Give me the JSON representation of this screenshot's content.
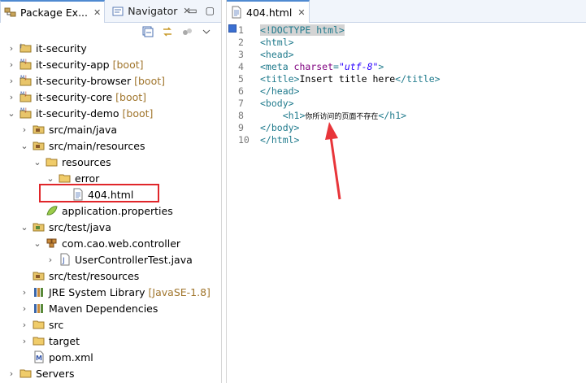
{
  "left_pane": {
    "tabs": [
      {
        "label": "Package Ex...",
        "active": true,
        "close": "✕"
      },
      {
        "label": "Navigator",
        "active": false,
        "close": "✕"
      }
    ],
    "tree": [
      {
        "label": "it-security",
        "suffix": "",
        "icon": "project-icon",
        "expanded": false,
        "depth": 0
      },
      {
        "label": "it-security-app",
        "suffix": "[boot]",
        "icon": "maven-project-icon",
        "expanded": false,
        "depth": 0
      },
      {
        "label": "it-security-browser",
        "suffix": "[boot]",
        "icon": "maven-project-icon",
        "expanded": false,
        "depth": 0
      },
      {
        "label": "it-security-core",
        "suffix": "[boot]",
        "icon": "maven-project-icon",
        "expanded": false,
        "depth": 0
      },
      {
        "label": "it-security-demo",
        "suffix": "[boot]",
        "icon": "maven-project-icon",
        "expanded": true,
        "depth": 0
      },
      {
        "label": "src/main/java",
        "suffix": "",
        "icon": "source-folder-icon",
        "expanded": false,
        "depth": 1
      },
      {
        "label": "src/main/resources",
        "suffix": "",
        "icon": "source-folder-icon",
        "expanded": true,
        "depth": 1
      },
      {
        "label": "resources",
        "suffix": "",
        "icon": "folder-icon",
        "expanded": true,
        "depth": 2
      },
      {
        "label": "error",
        "suffix": "",
        "icon": "folder-icon",
        "expanded": true,
        "depth": 3
      },
      {
        "label": "404.html",
        "suffix": "",
        "icon": "html-file-icon",
        "expanded": null,
        "depth": 4
      },
      {
        "label": "application.properties",
        "suffix": "",
        "icon": "properties-file-icon",
        "expanded": null,
        "depth": 2
      },
      {
        "label": "src/test/java",
        "suffix": "",
        "icon": "test-source-folder-icon",
        "expanded": true,
        "depth": 1
      },
      {
        "label": "com.cao.web.controller",
        "suffix": "",
        "icon": "package-icon",
        "expanded": true,
        "depth": 2
      },
      {
        "label": "UserControllerTest.java",
        "suffix": "",
        "icon": "java-file-icon",
        "expanded": false,
        "depth": 3
      },
      {
        "label": "src/test/resources",
        "suffix": "",
        "icon": "source-folder-icon",
        "expanded": null,
        "depth": 1
      },
      {
        "label": "JRE System Library",
        "suffix": "[JavaSE-1.8]",
        "icon": "library-icon",
        "expanded": false,
        "depth": 1
      },
      {
        "label": "Maven Dependencies",
        "suffix": "",
        "icon": "library-icon",
        "expanded": false,
        "depth": 1
      },
      {
        "label": "src",
        "suffix": "",
        "icon": "folder-icon",
        "expanded": false,
        "depth": 1
      },
      {
        "label": "target",
        "suffix": "",
        "icon": "folder-icon",
        "expanded": false,
        "depth": 1
      },
      {
        "label": "pom.xml",
        "suffix": "",
        "icon": "xml-file-icon",
        "expanded": null,
        "depth": 1
      },
      {
        "label": "Servers",
        "suffix": "",
        "icon": "folder-icon",
        "expanded": false,
        "depth": 0
      }
    ],
    "highlighted_item": "404.html"
  },
  "editor": {
    "tab": {
      "label": "404.html",
      "close": "✕"
    },
    "line_numbers": [
      "1",
      "2",
      "3",
      "4",
      "5",
      "6",
      "7",
      "8",
      "9",
      "10"
    ],
    "lines": [
      {
        "tokens": [
          {
            "t": "tag",
            "v": "<!DOCTYPE html>"
          }
        ]
      },
      {
        "tokens": [
          {
            "t": "tag",
            "v": "<html>"
          }
        ]
      },
      {
        "tokens": [
          {
            "t": "tag",
            "v": "<head>"
          }
        ]
      },
      {
        "tokens": [
          {
            "t": "tag",
            "v": "<meta "
          },
          {
            "t": "attr",
            "v": "charset"
          },
          {
            "t": "tag",
            "v": "="
          },
          {
            "t": "val",
            "v": "\"utf-8\""
          },
          {
            "t": "tag",
            "v": ">"
          }
        ]
      },
      {
        "tokens": [
          {
            "t": "tag",
            "v": "<title>"
          },
          {
            "t": "txt",
            "v": "Insert title here"
          },
          {
            "t": "tag",
            "v": "</title>"
          }
        ]
      },
      {
        "tokens": [
          {
            "t": "tag",
            "v": "</head>"
          }
        ]
      },
      {
        "tokens": [
          {
            "t": "tag",
            "v": "<body>"
          }
        ]
      },
      {
        "tokens": [
          {
            "t": "txt",
            "v": "    "
          },
          {
            "t": "tag",
            "v": "<h1>"
          },
          {
            "t": "cjk",
            "v": "你所访问的页面不存在"
          },
          {
            "t": "tag",
            "v": "</h1>"
          }
        ]
      },
      {
        "tokens": [
          {
            "t": "tag",
            "v": "</body>"
          }
        ]
      },
      {
        "tokens": [
          {
            "t": "tag",
            "v": "</html>"
          }
        ]
      }
    ]
  },
  "colors": {
    "highlight_box": "#e0262a",
    "arrow": "#e8353a",
    "tag": "#1f7a8c",
    "attr": "#7f007f",
    "value": "#2a00ff"
  }
}
